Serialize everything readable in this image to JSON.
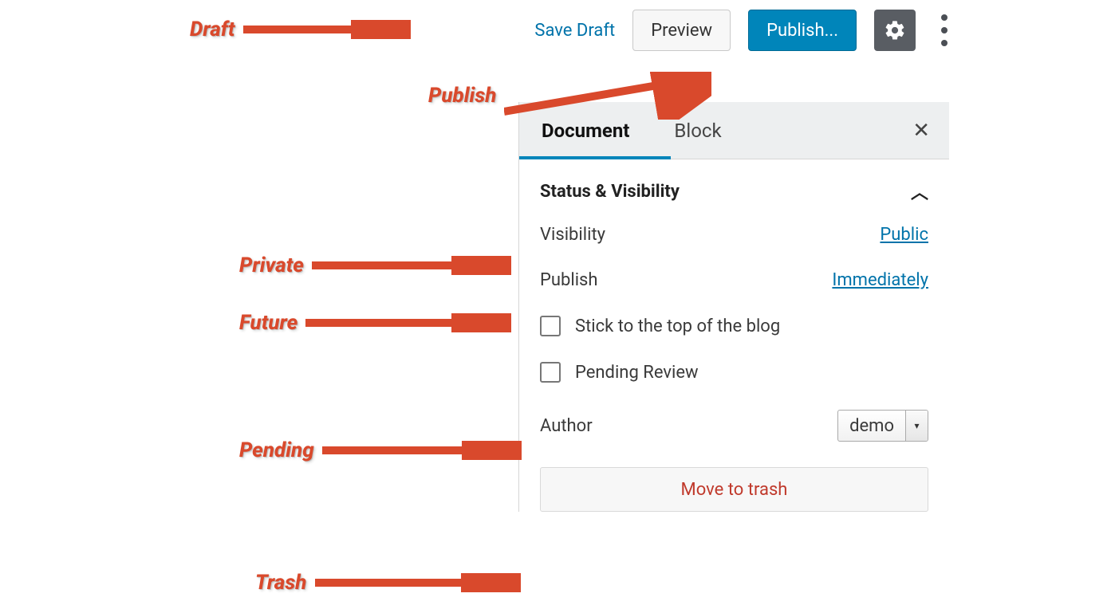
{
  "toolbar": {
    "save_draft": "Save Draft",
    "preview": "Preview",
    "publish": "Publish..."
  },
  "tabs": {
    "document": "Document",
    "block": "Block"
  },
  "section": {
    "title": "Status & Visibility"
  },
  "status": {
    "visibility_label": "Visibility",
    "visibility_value": "Public",
    "publish_label": "Publish",
    "publish_value": "Immediately",
    "stick_label": "Stick to the top of the blog",
    "pending_label": "Pending Review",
    "author_label": "Author",
    "author_value": "demo",
    "trash_label": "Move to trash"
  },
  "annotations": {
    "draft": "Draft",
    "publish": "Publish",
    "private": "Private",
    "future": "Future",
    "pending": "Pending",
    "trash": "Trash"
  }
}
